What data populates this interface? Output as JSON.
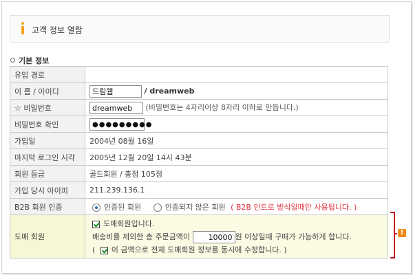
{
  "header": {
    "title": "고객 정보 열람",
    "icon": "info-icon",
    "accent_color": "#f3a21c"
  },
  "section": {
    "title": "기본 정보"
  },
  "rows": {
    "referrer": {
      "label": "유입 경로",
      "value": ""
    },
    "name_id": {
      "label": "이 름 / 아이디",
      "name_value": "드림웹",
      "id_text": "/ dreamweb"
    },
    "password": {
      "label": "☆ 비밀번호",
      "value": "dreamweb",
      "hint": "(비밀번호는 4자리이상 8자리 이하로 만듭니다.)"
    },
    "password_confirm": {
      "label": "비밀번호 확인",
      "masked_value": "●●●●●●●●●"
    },
    "join_date": {
      "label": "가입일",
      "value": "2004년 08월 16일"
    },
    "last_login": {
      "label": "마지막 로그인 시각",
      "value": "2005년 12월 20일 14시 43분"
    },
    "grade": {
      "label": "회원 등급",
      "value": "골드회원 / 총점 105점"
    },
    "join_ip": {
      "label": "가입 당시 아이피",
      "value": "211.239.136.1"
    },
    "b2b_auth": {
      "label": "B2B 회원 인증",
      "option_verified": "인증된 회원",
      "option_unverified": "인증되지 않은 회원",
      "selected": "인증된 회원",
      "note": "( B2B 인트로 방식일때만 사용됩니다. )",
      "note_color": "#e0303a"
    },
    "wholesale": {
      "label": "도매 회원",
      "checkbox_label": "도매회원입니다.",
      "checkbox_checked": true,
      "amount_prefix": "배송비를 제외한 총 주문금액이",
      "amount_value": "10000",
      "amount_suffix": "원 이상일때 구매가 가능하게 합니다.",
      "open_paren": "(",
      "apply_all_label": "이 금액으로 전체 도매회원 정보를 동시에 수정합니다.",
      "apply_all_checked": true,
      "close_paren": ")",
      "highlight_color": "#fbfbe4"
    }
  },
  "annotation": {
    "bracket_color": "#c8141e",
    "icon": "warning-icon",
    "icon_text": "!",
    "icon_color": "#f28a17"
  }
}
